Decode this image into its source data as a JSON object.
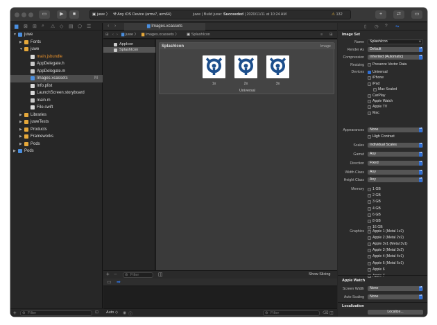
{
  "toolbar": {
    "scheme": "juwe",
    "device": "Any iOS Device (armv7, arm64)",
    "status_prefix": "juwe | Build juwe: ",
    "status_result": "Succeeded",
    "status_time": " | 2020/11/11 at 10:24 AM",
    "warning_count": "132"
  },
  "navigator": {
    "items": [
      {
        "label": "juwe",
        "kind": "proj",
        "indent": 0,
        "arrow": "open"
      },
      {
        "label": "Fonts",
        "kind": "folder",
        "indent": 1,
        "arrow": "closed"
      },
      {
        "label": "juwe",
        "kind": "folder",
        "indent": 1,
        "arrow": "open"
      },
      {
        "label": "main.jsbundle",
        "kind": "file",
        "indent": 2,
        "arrow": "",
        "color": "#e8912c"
      },
      {
        "label": "AppDelegate.h",
        "kind": "hfile",
        "indent": 2,
        "arrow": ""
      },
      {
        "label": "AppDelegate.m",
        "kind": "hfile",
        "indent": 2,
        "arrow": ""
      },
      {
        "label": "Images.xcassets",
        "kind": "proj",
        "indent": 2,
        "arrow": "",
        "selected": true,
        "badge": "M"
      },
      {
        "label": "Info.plist",
        "kind": "file",
        "indent": 2,
        "arrow": ""
      },
      {
        "label": "LaunchScreen.storyboard",
        "kind": "file",
        "indent": 2,
        "arrow": ""
      },
      {
        "label": "main.m",
        "kind": "hfile",
        "indent": 2,
        "arrow": ""
      },
      {
        "label": "File.swift",
        "kind": "file",
        "indent": 2,
        "arrow": ""
      },
      {
        "label": "Libraries",
        "kind": "folder",
        "indent": 1,
        "arrow": "closed"
      },
      {
        "label": "juweTests",
        "kind": "folder",
        "indent": 1,
        "arrow": "closed"
      },
      {
        "label": "Products",
        "kind": "folder",
        "indent": 1,
        "arrow": "closed"
      },
      {
        "label": "Frameworks",
        "kind": "folder",
        "indent": 1,
        "arrow": "closed"
      },
      {
        "label": "Pods",
        "kind": "folder",
        "indent": 1,
        "arrow": "closed"
      },
      {
        "label": "Pods",
        "kind": "proj",
        "indent": 0,
        "arrow": "closed"
      }
    ],
    "filter_placeholder": "Filter"
  },
  "editor": {
    "tab_title": "Images.xcassets",
    "jump_bar": [
      " juwe ",
      " Images.xcassets ",
      " SplashIcon"
    ],
    "assets": [
      {
        "label": "AppIcon",
        "selected": false
      },
      {
        "label": "SplashIcon",
        "selected": true
      }
    ],
    "asset_filter_placeholder": "Filter",
    "set_name": "SplashIcon",
    "set_type": "Image",
    "scales": [
      "1x",
      "2x",
      "3x"
    ],
    "universal": "Universal",
    "show_slicing": "Show Slicing",
    "auto_label": "Auto ◇",
    "console_filter_placeholder": "Filter"
  },
  "inspector": {
    "section_title": "Image Set",
    "name_label": "Name",
    "name_value": "SplashIcon",
    "render_label": "Render As",
    "render_value": "Default",
    "compression_label": "Compression",
    "compression_value": "Inherited (Automatic)",
    "resizing_label": "Resizing",
    "resizing_value": "Preserve Vector Data",
    "devices_label": "Devices",
    "devices": [
      {
        "label": "Universal",
        "on": true,
        "indent": 0
      },
      {
        "label": "iPhone",
        "on": false,
        "indent": 0
      },
      {
        "label": "iPad",
        "on": false,
        "indent": 0
      },
      {
        "label": "Mac Scaled",
        "on": false,
        "indent": 1
      },
      {
        "label": "CarPlay",
        "on": false,
        "indent": 0
      },
      {
        "label": "Apple Watch",
        "on": false,
        "indent": 0
      },
      {
        "label": "Apple TV",
        "on": false,
        "indent": 0
      },
      {
        "label": "Mac",
        "on": false,
        "indent": 0
      }
    ],
    "appearances_label": "Appearances",
    "appearances_value": "None",
    "high_contrast": "High Contrast",
    "scales_label": "Scales",
    "scales_value": "Individual Scales",
    "gamut_label": "Gamut",
    "gamut_value": "Any",
    "direction_label": "Direction",
    "direction_value": "Fixed",
    "width_label": "Width Class",
    "width_value": "Any",
    "height_label": "Height Class",
    "height_value": "Any",
    "memory_label": "Memory",
    "memory": [
      "1 GB",
      "2 GB",
      "3 GB",
      "4 GB",
      "6 GB",
      "8 GB",
      "16 GB"
    ],
    "graphics_label": "Graphics",
    "graphics": [
      "Apple 1 (Metal 1v2)",
      "Apple 2 (Metal 2v2)",
      "Apple 3v1 (Metal 3v1)",
      "Apple 3 (Metal 3v2)",
      "Apple 4 (Metal 4v1)",
      "Apple 5 (Metal 5v1)",
      "Apple 6",
      "Apple 7"
    ],
    "watch_title": "Apple Watch",
    "screen_width_label": "Screen Width",
    "screen_width_value": "None",
    "auto_scaling_label": "Auto Scaling",
    "auto_scaling_value": "None",
    "localization_title": "Localization",
    "localize_button": "Localize..."
  },
  "colors": {
    "accent": "#2f6fd6",
    "brand_icon": "#1d4f8c",
    "success": "#8fd18f",
    "warning": "#e6b33a"
  }
}
